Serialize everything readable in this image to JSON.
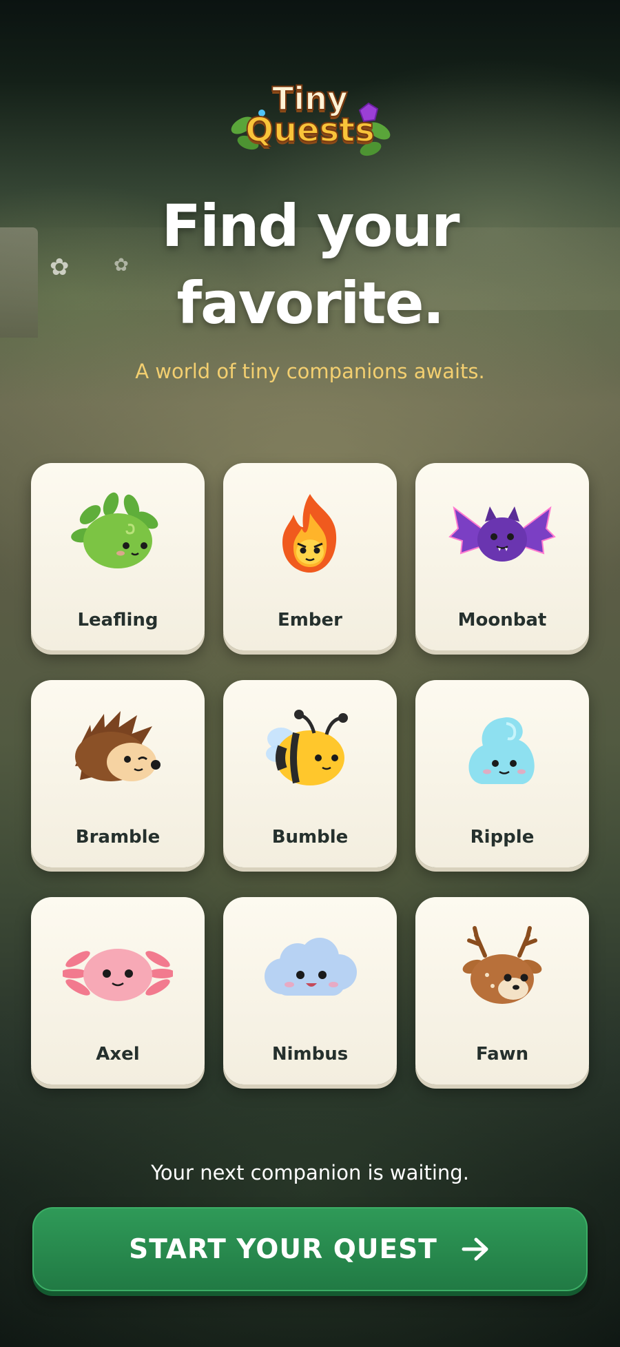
{
  "app": {
    "logo_line1": "Tiny",
    "logo_line2": "Quests"
  },
  "hero": {
    "title_line1": "Find your",
    "title_line2": "favorite.",
    "tagline": "A world of tiny companions awaits."
  },
  "companions": [
    {
      "name": "Leafling",
      "icon": "leafling-creature-icon"
    },
    {
      "name": "Ember",
      "icon": "ember-flame-icon"
    },
    {
      "name": "Moonbat",
      "icon": "moonbat-icon"
    },
    {
      "name": "Bramble",
      "icon": "hedgehog-icon"
    },
    {
      "name": "Bumble",
      "icon": "bee-icon"
    },
    {
      "name": "Ripple",
      "icon": "water-slime-icon"
    },
    {
      "name": "Axel",
      "icon": "axolotl-icon"
    },
    {
      "name": "Nimbus",
      "icon": "cloud-icon"
    },
    {
      "name": "Fawn",
      "icon": "deer-icon"
    }
  ],
  "footer": {
    "waiting_text": "Your next companion is waiting.",
    "cta_label": "START YOUR QUEST",
    "cta_icon": "arrow-right-icon"
  },
  "colors": {
    "accent_text": "#f3cf70",
    "cta_green": "#2f9a58",
    "card_bg": "#fdfaf0"
  }
}
